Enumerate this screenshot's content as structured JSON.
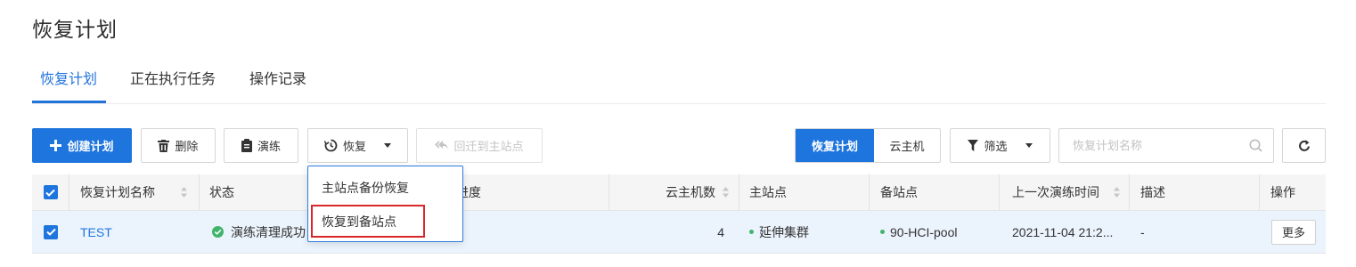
{
  "page": {
    "title": "恢复计划"
  },
  "tabs": [
    {
      "label": "恢复计划",
      "active": true
    },
    {
      "label": "正在执行任务",
      "active": false
    },
    {
      "label": "操作记录",
      "active": false
    }
  ],
  "toolbar": {
    "create_label": "创建计划",
    "delete_label": "删除",
    "drill_label": "演练",
    "restore_label": "恢复",
    "migrate_back_label": "回迁到主站点"
  },
  "view_toggle": {
    "plan_label": "恢复计划",
    "vm_label": "云主机",
    "selected": "恢复计划"
  },
  "filter": {
    "label": "筛选"
  },
  "search": {
    "placeholder": "恢复计划名称",
    "value": ""
  },
  "table": {
    "headers": {
      "name": "恢复计划名称",
      "status": "状态",
      "progress": "进度",
      "vm_count": "云主机数",
      "primary_site": "主站点",
      "backup_site": "备站点",
      "last_drill": "上一次演练时间",
      "description": "描述",
      "actions": "操作"
    },
    "rows": [
      {
        "checked": true,
        "name": "TEST",
        "status": "演练清理成功",
        "vm_count": "4",
        "primary_site": "延伸集群",
        "backup_site": "90-HCI-pool",
        "last_drill": "2021-11-04 21:2...",
        "description": "-",
        "more_label": "更多"
      }
    ]
  },
  "restore_menu": {
    "items": [
      "主站点备份恢复",
      "恢复到备站点"
    ],
    "highlighted": "恢复到备站点"
  },
  "colors": {
    "accent": "#1f75de",
    "success": "#3fb56b",
    "highlight_box": "#d8282a",
    "selected_row": "#ebf3fd"
  }
}
